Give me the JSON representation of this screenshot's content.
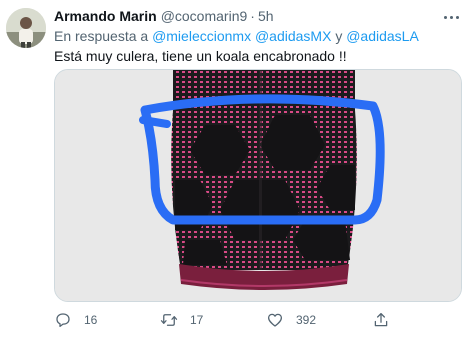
{
  "tweet": {
    "name": "Armando Marin",
    "handle": "@cocomarin9",
    "separator": "·",
    "time": "5h",
    "reply_prefix": "En respuesta a ",
    "mention_1": "@mieleccionmx",
    "mention_2": "@adidasMX",
    "conjunction": " y ",
    "mention_3": "@adidasLA",
    "text": "Está muy culera, tiene un koala encabronado !!"
  },
  "actions": {
    "reply_icon": "reply-icon",
    "reply_count": "16",
    "retweet_icon": "retweet-icon",
    "retweet_count": "17",
    "like_icon": "heart-icon",
    "like_count": "392",
    "share_icon": "share-icon"
  },
  "colors": {
    "link": "#1d9bf0",
    "secondary_text": "#536471",
    "jersey_base": "#1c1b1d",
    "jersey_pattern": "#d94a86",
    "jersey_hem": "#7a1f3d",
    "annotation": "#2a6df5"
  }
}
